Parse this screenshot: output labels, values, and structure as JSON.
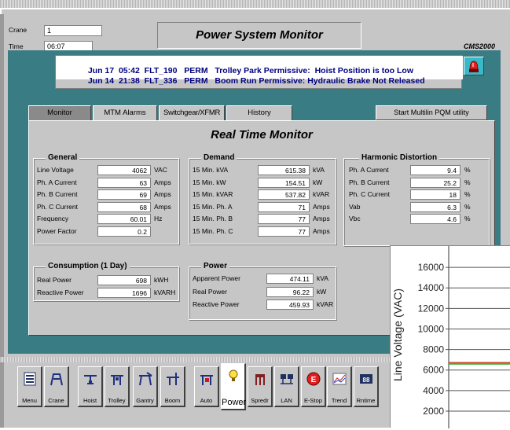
{
  "header": {
    "crane_label": "Crane",
    "crane_value": "1",
    "time_label": "Time",
    "time_value": "06:07",
    "title": "Power System Monitor",
    "product": "CMS2000"
  },
  "alarms": [
    {
      "date": "Jun 17",
      "time": "05:42",
      "code": "FLT_190",
      "type": "PERM",
      "message": "Trolley Park Permissive:  Hoist Position is too Low"
    },
    {
      "date": "Jun 14",
      "time": "21:38",
      "code": "FLT_336",
      "type": "PERM",
      "message": "Boom Run Permissive: Hydraulic Brake Not Released"
    }
  ],
  "tabs": [
    "Monitor",
    "MTM Alarms",
    "Switchgear/XFMR",
    "History"
  ],
  "start_button": "Start Multilin PQM utility",
  "monitor_title": "Real Time Monitor",
  "general": {
    "title": "General",
    "rows": [
      {
        "label": "Line Voltage",
        "value": "4062",
        "unit": "VAC"
      },
      {
        "label": "Ph. A Current",
        "value": "63",
        "unit": "Amps"
      },
      {
        "label": "Ph. B Current",
        "value": "69",
        "unit": "Amps"
      },
      {
        "label": "Ph. C Current",
        "value": "68",
        "unit": "Amps"
      },
      {
        "label": "Frequency",
        "value": "60.01",
        "unit": "Hz"
      },
      {
        "label": "Power Factor",
        "value": "0.2",
        "unit": ""
      }
    ]
  },
  "demand": {
    "title": "Demand",
    "rows": [
      {
        "label": "15 Min. kVA",
        "value": "615.38",
        "unit": "kVA"
      },
      {
        "label": "15 Min. kW",
        "value": "154.51",
        "unit": "kW"
      },
      {
        "label": "15 Min. kVAR",
        "value": "537.82",
        "unit": "kVAR"
      },
      {
        "label": "15 Min. Ph. A",
        "value": "71",
        "unit": "Amps"
      },
      {
        "label": "15 Min. Ph. B",
        "value": "77",
        "unit": "Amps"
      },
      {
        "label": "15 Min. Ph. C",
        "value": "77",
        "unit": "Amps"
      }
    ]
  },
  "harmonic": {
    "title": "Harmonic Distortion",
    "rows": [
      {
        "label": "Ph. A Current",
        "value": "9.4",
        "unit": "%"
      },
      {
        "label": "Ph. B Current",
        "value": "25.2",
        "unit": "%"
      },
      {
        "label": "Ph. C Current",
        "value": "18",
        "unit": "%"
      },
      {
        "label": "Vab",
        "value": "6.3",
        "unit": "%"
      },
      {
        "label": "Vbc",
        "value": "4.6",
        "unit": "%"
      }
    ]
  },
  "consumption": {
    "title": "Consumption (1 Day)",
    "rows": [
      {
        "label": "Real Power",
        "value": "698",
        "unit": "kWH"
      },
      {
        "label": "Reactive Power",
        "value": "1696",
        "unit": "kVARH"
      }
    ]
  },
  "power": {
    "title": "Power",
    "rows": [
      {
        "label": "Apparent Power",
        "value": "474.11",
        "unit": "kVA"
      },
      {
        "label": "Real Power",
        "value": "96.22",
        "unit": "kW"
      },
      {
        "label": "Reactive Power",
        "value": "459.93",
        "unit": "kVAR"
      }
    ]
  },
  "toolbar": [
    "Menu",
    "Crane",
    "Hoist",
    "Trolley",
    "Gantry",
    "Boom",
    "Auto",
    "Power",
    "Spredr",
    "LAN",
    "E-Stop",
    "Trend",
    "Rntime"
  ],
  "chart_data": {
    "type": "line",
    "ylabel": "Line Voltage (VAC)",
    "ylim": [
      1000,
      17000
    ],
    "yticks": [
      2000,
      4000,
      6000,
      8000,
      10000,
      12000,
      14000,
      16000
    ],
    "grid": true,
    "series": [
      {
        "color": "#e04020",
        "values": [
          6700,
          6700
        ]
      },
      {
        "color": "#40b040",
        "values": [
          6600,
          6600
        ]
      }
    ]
  }
}
